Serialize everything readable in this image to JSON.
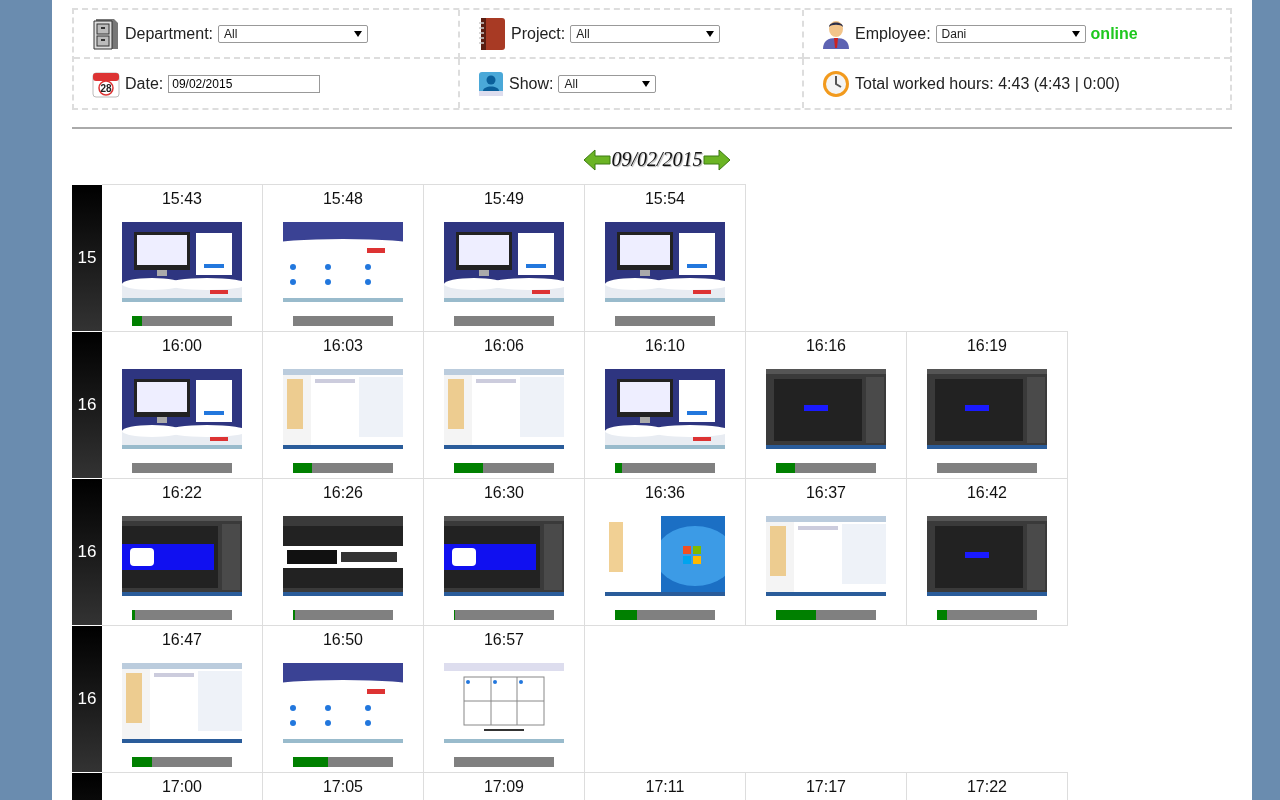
{
  "filters": [
    {
      "kind": "department",
      "label": "Department:",
      "value": "All"
    },
    {
      "kind": "project",
      "label": "Project:",
      "value": "All"
    },
    {
      "kind": "employee",
      "label": "Employee:",
      "value": "Dani",
      "status": "online"
    },
    {
      "kind": "date",
      "label": "Date:",
      "value": "09/02/2015",
      "icon_day": "28"
    },
    {
      "kind": "show",
      "label": "Show:",
      "value": "All"
    },
    {
      "kind": "total",
      "label": "Total worked hours: 4:43 (4:43 | 0:00)"
    }
  ],
  "date_nav": {
    "date": "09/02/2015"
  },
  "hours": [
    {
      "hour": "15",
      "shots": [
        {
          "time": "15:43",
          "level": 0.1
        },
        {
          "time": "15:48",
          "level": 0
        },
        {
          "time": "15:49",
          "level": 0
        },
        {
          "time": "15:54",
          "level": 0
        }
      ]
    },
    {
      "hour": "16",
      "shots": [
        {
          "time": "16:00",
          "level": 0
        },
        {
          "time": "16:03",
          "level": 0.19
        },
        {
          "time": "16:06",
          "level": 0.29
        },
        {
          "time": "16:10",
          "level": 0.07
        },
        {
          "time": "16:16",
          "level": 0.19
        },
        {
          "time": "16:19",
          "level": 0
        }
      ]
    },
    {
      "hour": "16",
      "shots": [
        {
          "time": "16:22",
          "level": 0.03
        },
        {
          "time": "16:26",
          "level": 0.02
        },
        {
          "time": "16:30",
          "level": 0.01
        },
        {
          "time": "16:36",
          "level": 0.22
        },
        {
          "time": "16:37",
          "level": 0.4
        },
        {
          "time": "16:42",
          "level": 0.1
        }
      ]
    },
    {
      "hour": "16",
      "shots": [
        {
          "time": "16:47",
          "level": 0.2
        },
        {
          "time": "16:50",
          "level": 0.35
        },
        {
          "time": "16:57",
          "level": 0
        }
      ]
    },
    {
      "shots": [
        {
          "time": "17:00"
        },
        {
          "time": "17:05"
        },
        {
          "time": "17:09"
        },
        {
          "time": "17:11"
        },
        {
          "time": "17:17"
        },
        {
          "time": "17:22"
        }
      ]
    }
  ]
}
